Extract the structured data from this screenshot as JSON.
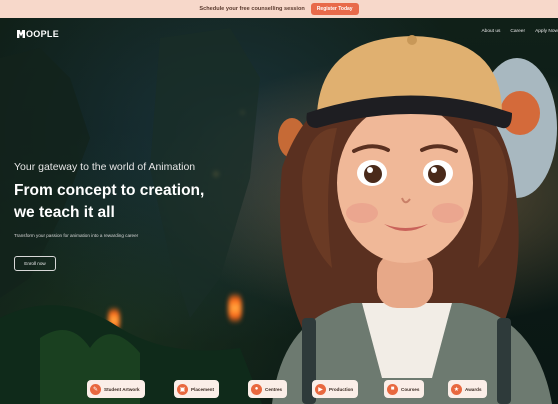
{
  "announcement": {
    "message": "Schedule your free counselling session",
    "button": "Register Today"
  },
  "brand": {
    "logo_text": "OOPLE"
  },
  "nav": {
    "links": [
      "About us",
      "Career",
      "Apply Now"
    ]
  },
  "hero": {
    "tagline": "Your gateway to the world of Animation",
    "headline_line1": "From concept to creation,",
    "headline_line2": "we teach it all",
    "subtext": "Transform your passion for animation into a rewarding career",
    "cta": "Enroll now"
  },
  "quicklinks": [
    {
      "label": "Student Artwork",
      "icon": "palette-icon"
    },
    {
      "label": "Placement",
      "icon": "briefcase-icon"
    },
    {
      "label": "Centres",
      "icon": "location-icon"
    },
    {
      "label": "Production",
      "icon": "film-icon"
    },
    {
      "label": "Courses",
      "icon": "book-icon"
    },
    {
      "label": "Awards",
      "icon": "trophy-icon"
    }
  ],
  "colors": {
    "accent": "#e8683f",
    "banner_bg": "#f7d8ca"
  }
}
